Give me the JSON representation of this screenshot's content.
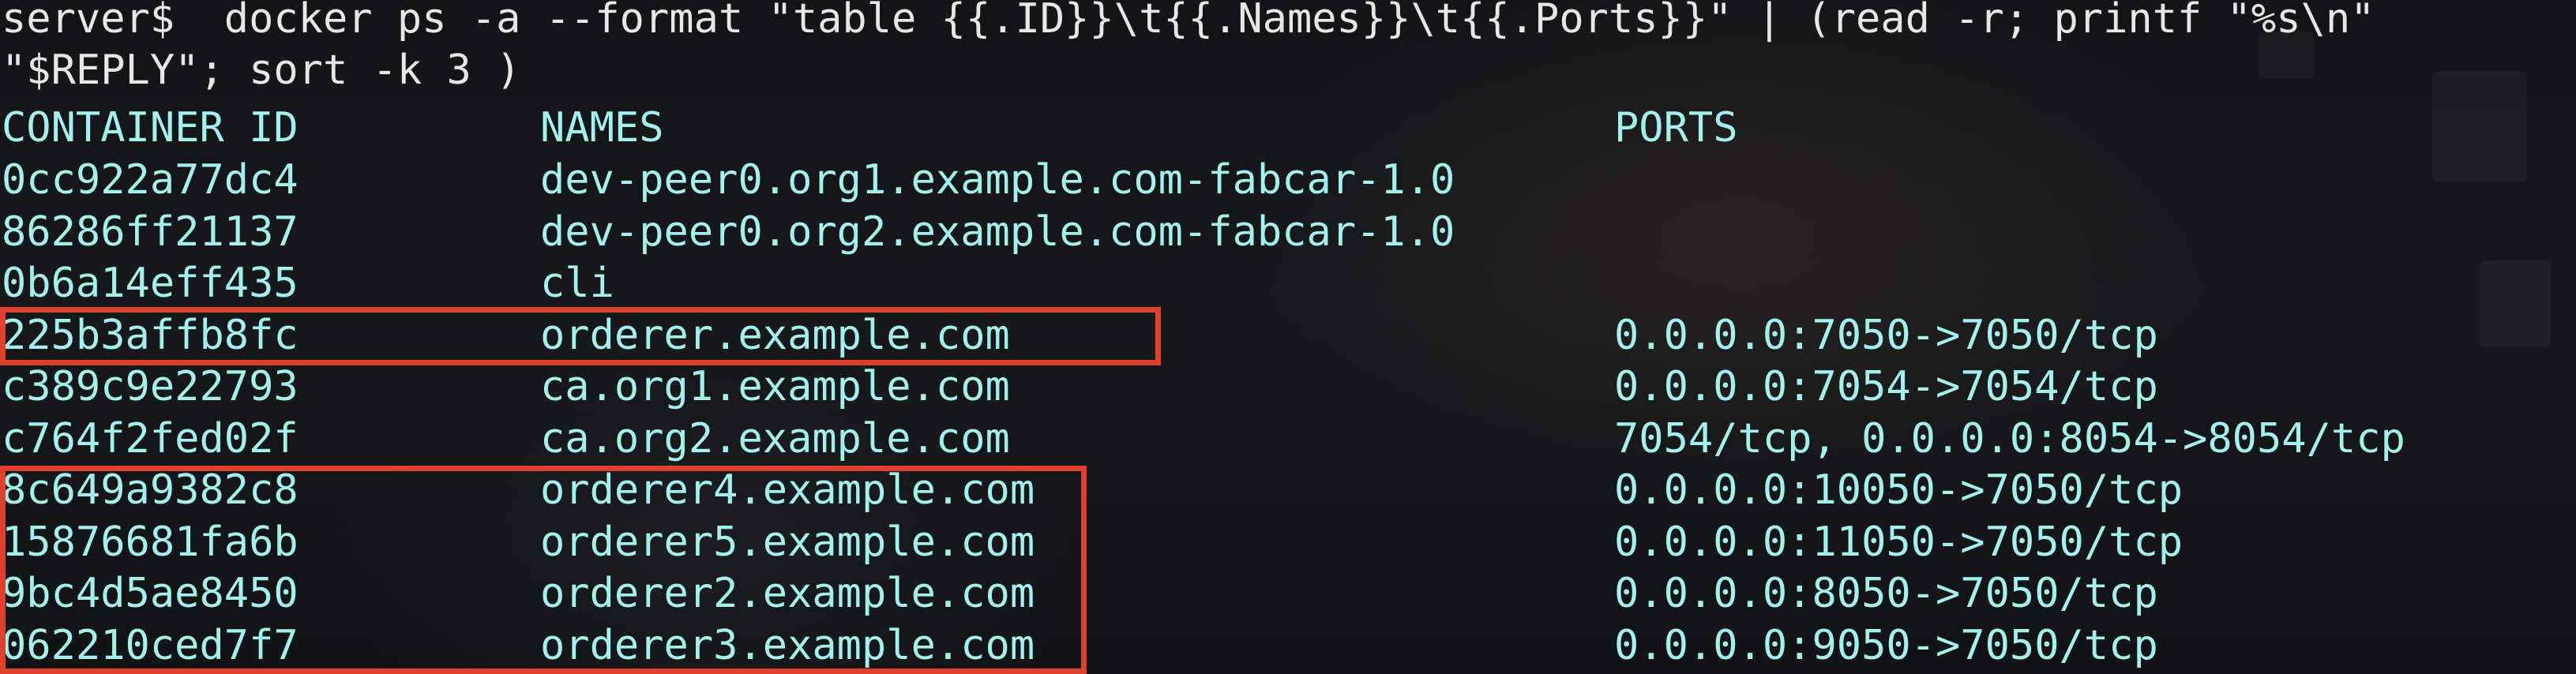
{
  "terminal": {
    "command_line_1": "server$  docker ps -a --format \"table {{.ID}}\\t{{.Names}}\\t{{.Ports}}\" | (read -r; printf \"%s\\n\"",
    "command_line_2": "\"$REPLY\"; sort -k 3 )",
    "headers": {
      "id": "CONTAINER ID",
      "names": "NAMES",
      "ports": "PORTS"
    },
    "rows": [
      {
        "id": "0cc922a77dc4",
        "name": "dev-peer0.org1.example.com-fabcar-1.0",
        "ports": ""
      },
      {
        "id": "86286ff21137",
        "name": "dev-peer0.org2.example.com-fabcar-1.0",
        "ports": ""
      },
      {
        "id": "0b6a14eff435",
        "name": "cli",
        "ports": ""
      },
      {
        "id": "225b3affb8fc",
        "name": "orderer.example.com",
        "ports": "0.0.0.0:7050->7050/tcp"
      },
      {
        "id": "c389c9e22793",
        "name": "ca.org1.example.com",
        "ports": "0.0.0.0:7054->7054/tcp"
      },
      {
        "id": "c764f2fed02f",
        "name": "ca.org2.example.com",
        "ports": "7054/tcp, 0.0.0.0:8054->8054/tcp"
      },
      {
        "id": "8c649a9382c8",
        "name": "orderer4.example.com",
        "ports": "0.0.0.0:10050->7050/tcp"
      },
      {
        "id": "15876681fa6b",
        "name": "orderer5.example.com",
        "ports": "0.0.0.0:11050->7050/tcp"
      },
      {
        "id": "9bc4d5ae8450",
        "name": "orderer2.example.com",
        "ports": "0.0.0.0:8050->7050/tcp"
      },
      {
        "id": "062210ced7f7",
        "name": "orderer3.example.com",
        "ports": "0.0.0.0:9050->7050/tcp"
      }
    ],
    "colors": {
      "text": "#a4f0ee",
      "command": "#e6e8e8",
      "highlight": "#e0412f",
      "background": "#121416"
    }
  }
}
